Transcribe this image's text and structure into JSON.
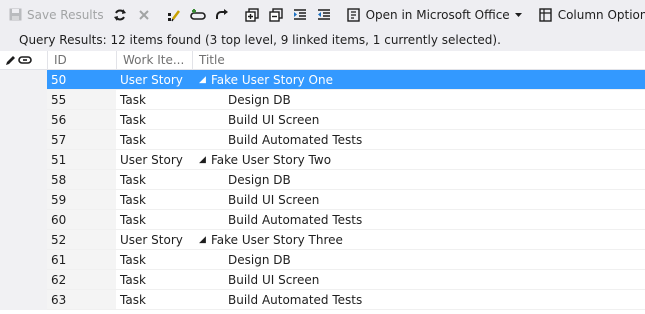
{
  "toolbar": {
    "save_label": "Save Results",
    "open_office_label": "Open in Microsoft Office",
    "column_options_label": "Column Options"
  },
  "status": {
    "text": "Query Results: 12 items found (3 top level, 9 linked items, 1 currently selected)."
  },
  "grid": {
    "columns": {
      "id": "ID",
      "type": "Work Ite...",
      "title": "Title"
    },
    "rows": [
      {
        "id": "50",
        "type": "User Story",
        "title": "Fake User Story One",
        "parent": true,
        "selected": true
      },
      {
        "id": "55",
        "type": "Task",
        "title": "Design DB",
        "parent": false,
        "selected": false
      },
      {
        "id": "56",
        "type": "Task",
        "title": "Build UI Screen",
        "parent": false,
        "selected": false
      },
      {
        "id": "57",
        "type": "Task",
        "title": "Build Automated Tests",
        "parent": false,
        "selected": false
      },
      {
        "id": "51",
        "type": "User Story",
        "title": "Fake User Story Two",
        "parent": true,
        "selected": false
      },
      {
        "id": "58",
        "type": "Task",
        "title": "Design DB",
        "parent": false,
        "selected": false
      },
      {
        "id": "59",
        "type": "Task",
        "title": "Build UI Screen",
        "parent": false,
        "selected": false
      },
      {
        "id": "60",
        "type": "Task",
        "title": "Build Automated Tests",
        "parent": false,
        "selected": false
      },
      {
        "id": "52",
        "type": "User Story",
        "title": "Fake User Story Three",
        "parent": true,
        "selected": false
      },
      {
        "id": "61",
        "type": "Task",
        "title": "Design DB",
        "parent": false,
        "selected": false
      },
      {
        "id": "62",
        "type": "Task",
        "title": "Build UI Screen",
        "parent": false,
        "selected": false
      },
      {
        "id": "63",
        "type": "Task",
        "title": "Build Automated Tests",
        "parent": false,
        "selected": false
      }
    ]
  },
  "icons": {
    "save": "save-icon",
    "refresh": "refresh-icon",
    "stop": "stop-icon",
    "edit_query": "edit-query-icon",
    "new_linked": "new-linked-item-icon",
    "link": "link-icon",
    "expand_all": "expand-all-icon",
    "collapse_all": "collapse-all-icon",
    "indent": "indent-icon",
    "outdent": "outdent-icon",
    "office": "office-icon",
    "column_options": "column-options-icon",
    "edit_column": "pencil-icon",
    "link_column": "chain-link-icon",
    "expanded": "expanded-triangle-icon"
  },
  "colors": {
    "selection": "#3399ff",
    "toolbar_bg": "#eeeef2"
  }
}
